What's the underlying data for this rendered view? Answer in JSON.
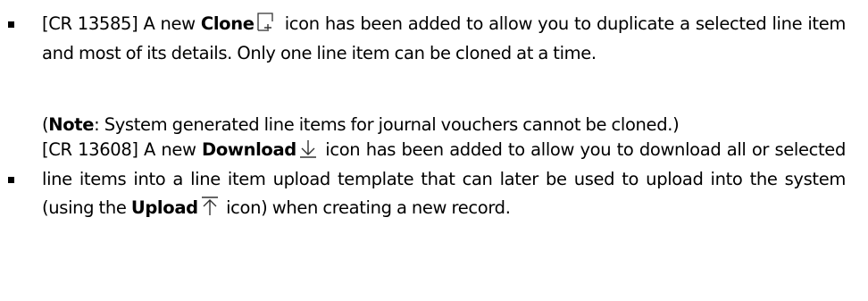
{
  "bullets": [
    {
      "cr": "[CR 13585]",
      "text_a": " A new ",
      "bold": "Clone",
      "icon": "clone-icon",
      "text_b": " icon has been added to allow you to duplicate a selected line item and most of its details. Only one line item can be cloned at a time."
    },
    {
      "cr": "[CR 13608]",
      "text_a": " A new ",
      "bold": "Download",
      "icon": "download-icon",
      "text_b": " icon has been added to allow you to download all or selected line items into a line item upload template that can later be used to upload into the system (using the ",
      "bold2": "Upload",
      "icon2": "upload-icon",
      "text_c": " icon) when creating a new record."
    }
  ],
  "note": {
    "open_paren": "(",
    "label": "Note",
    "text": ": System generated line items for journal vouchers cannot be cloned.)"
  }
}
